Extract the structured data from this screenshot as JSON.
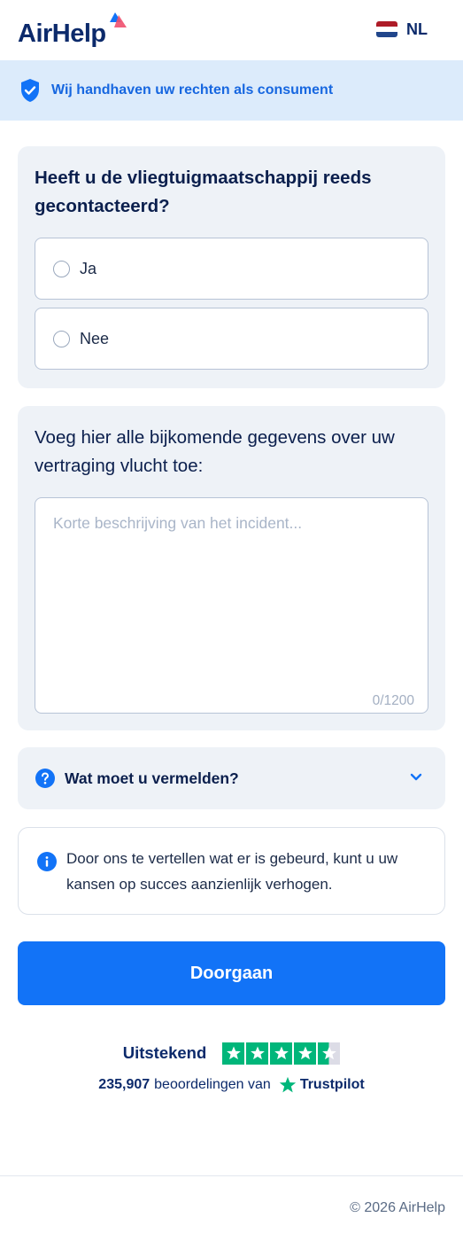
{
  "header": {
    "logo_text": "AirHelp",
    "language": "NL"
  },
  "banner": {
    "text": "Wij handhaven uw rechten als consument"
  },
  "question1": {
    "title": "Heeft u de vliegtuigmaatschappij reeds gecontacteerd?",
    "options": [
      {
        "label": "Ja",
        "selected": false
      },
      {
        "label": "Nee",
        "selected": false
      }
    ]
  },
  "question2": {
    "title": "Voeg hier alle bijkomende gegevens over uw vertraging vlucht toe:",
    "placeholder": "Korte beschrijving van het incident...",
    "value": "",
    "counter": "0/1200"
  },
  "accordion": {
    "label": "Wat moet u vermelden?"
  },
  "info": {
    "text": "Door ons te vertellen wat er is gebeurd, kunt u uw kansen op succes aanzienlijk verhogen."
  },
  "cta": {
    "label": "Doorgaan"
  },
  "trustpilot": {
    "rating_label": "Uitstekend",
    "stars": 4.5,
    "review_count": "235,907",
    "reviews_text": "beoordelingen van",
    "brand": "Trustpilot"
  },
  "footer": {
    "copyright": "© 2026 AirHelp"
  },
  "colors": {
    "primary": "#1273f7",
    "navy": "#0c2a6b",
    "banner_bg": "#dcebfb",
    "card_bg": "#eef2f7",
    "trustpilot_green": "#00b67a"
  },
  "icons": [
    "shield-check-icon",
    "netherlands-flag-icon",
    "question-circle-icon",
    "chevron-down-icon",
    "info-circle-icon",
    "trustpilot-star-icon"
  ]
}
